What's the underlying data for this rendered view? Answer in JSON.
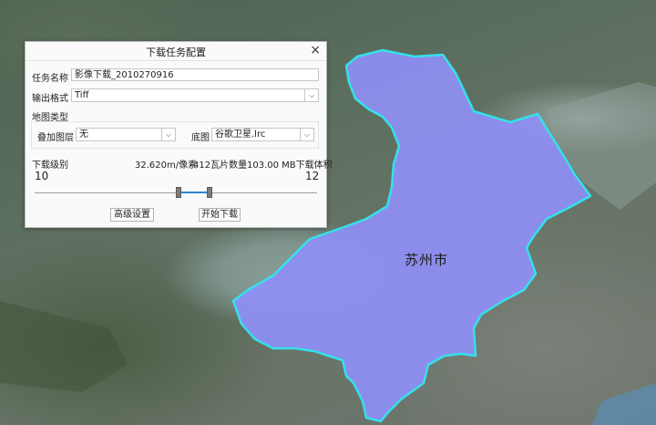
{
  "map": {
    "city_label": "苏州市",
    "region_fill": "#8f8ff5",
    "region_stroke": "#35e0ec"
  },
  "dialog": {
    "title": "下载任务配置",
    "close_symbol": "×",
    "task_name_label": "任务名称",
    "task_name_value": "影像下载_2010270916",
    "format_label": "输出格式",
    "format_value": "Tiff",
    "map_type_label": "地图类型",
    "overlay_label": "叠加图层",
    "overlay_value": "无",
    "basemap_label": "底图",
    "basemap_value": "谷歌卫星.lrc",
    "level_label": "下载级别",
    "resolution_text": "32.620m/像素",
    "tile_count_text": "412瓦片数量",
    "volume_text": "103.00 MB下载体积",
    "level_min": "10",
    "level_max": "12",
    "advanced_button": "高级设置",
    "start_button": "开始下载"
  }
}
